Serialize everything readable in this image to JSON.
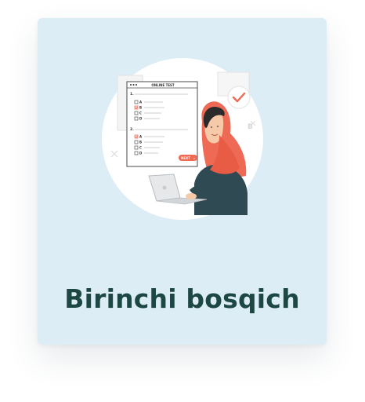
{
  "card": {
    "title": "Birinchi bosqich",
    "illustration": {
      "icon": "online-test-illustration",
      "test_header": "ONLINE TEST",
      "question_1_number": "1.",
      "question_2_number": "2.",
      "options": [
        "A",
        "B",
        "C",
        "D"
      ],
      "next_label": "NEXT",
      "next_arrow": "›",
      "selected_q1": "B",
      "selected_q2": "A"
    }
  },
  "colors": {
    "card_bg": "#ddedf6",
    "title": "#1d4743",
    "accent": "#ee6a55"
  }
}
